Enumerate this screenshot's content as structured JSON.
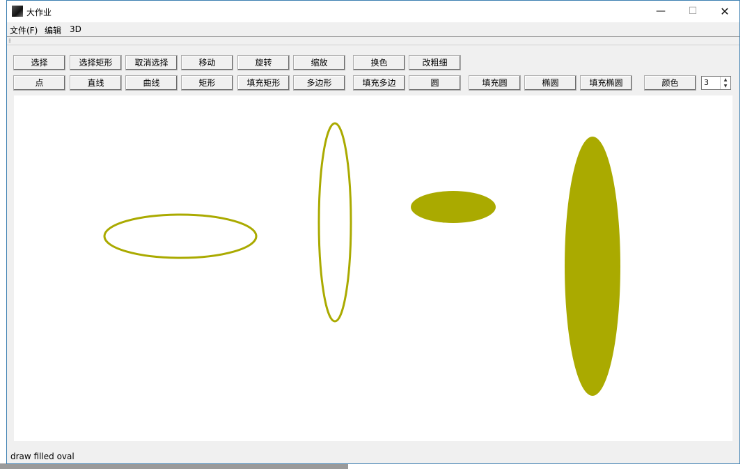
{
  "window": {
    "title": "大作业"
  },
  "window_controls": {
    "minimize": "—",
    "maximize": "☐",
    "close": "✕"
  },
  "menu": {
    "file": "文件(F)",
    "edit": "编辑",
    "three_d": "3D"
  },
  "toolbar": {
    "row1": [
      "选择",
      "选择矩形",
      "取消选择",
      "移动",
      "旋转",
      "缩放",
      "换色",
      "改粗细"
    ],
    "row2": [
      "点",
      "直线",
      "曲线",
      "矩形",
      "填充矩形",
      "多边形",
      "填充多边",
      "圆",
      "填充圆",
      "椭圆",
      "填充椭圆",
      "颜色"
    ],
    "line_width": "3"
  },
  "canvas": {
    "shape_color": "#aaaa00",
    "shapes": [
      {
        "type": "oval-outline",
        "label": ""
      },
      {
        "type": "oval-outline",
        "label": ""
      },
      {
        "type": "oval-filled",
        "label": ""
      },
      {
        "type": "oval-filled",
        "label": ""
      }
    ]
  },
  "status": {
    "text": "draw filled oval"
  }
}
